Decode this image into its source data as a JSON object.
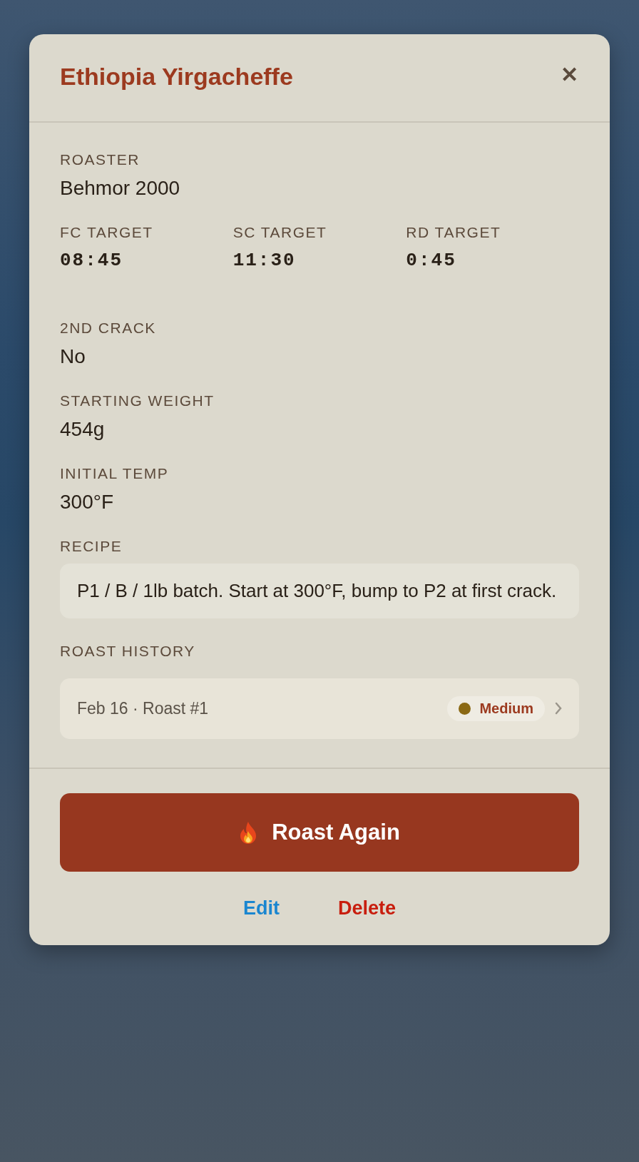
{
  "dialog": {
    "title": "Ethiopia Yirgacheffe",
    "close": "✕"
  },
  "fields": [
    {
      "kind": "single",
      "label": "ROASTER",
      "value": "Behmor 2000"
    },
    {
      "kind": "targets",
      "items": [
        {
          "label": "FC TARGET",
          "value": "08:45"
        },
        {
          "label": "SC TARGET",
          "value": "11:30"
        },
        {
          "label": "RD TARGET",
          "value": "0:45"
        }
      ]
    },
    {
      "kind": "single",
      "label": "2ND CRACK",
      "value": "No"
    },
    {
      "kind": "single",
      "label": "STARTING WEIGHT",
      "value": "454g"
    },
    {
      "kind": "single",
      "label": "INITIAL TEMP",
      "value": "300°F"
    },
    {
      "kind": "note",
      "label": "RECIPE",
      "value": "P1 / B / 1lb batch. Start at 300°F, bump to P2 at first crack."
    }
  ],
  "history": {
    "label": "ROAST HISTORY",
    "rows": [
      {
        "title": "Feb 16 · Roast #1",
        "level": "Medium",
        "color": "#8b6914"
      }
    ]
  },
  "primary_button": "Roast Again",
  "actions": [
    {
      "kind": "edit",
      "label": "Edit"
    },
    {
      "kind": "delete",
      "label": "Delete"
    }
  ]
}
